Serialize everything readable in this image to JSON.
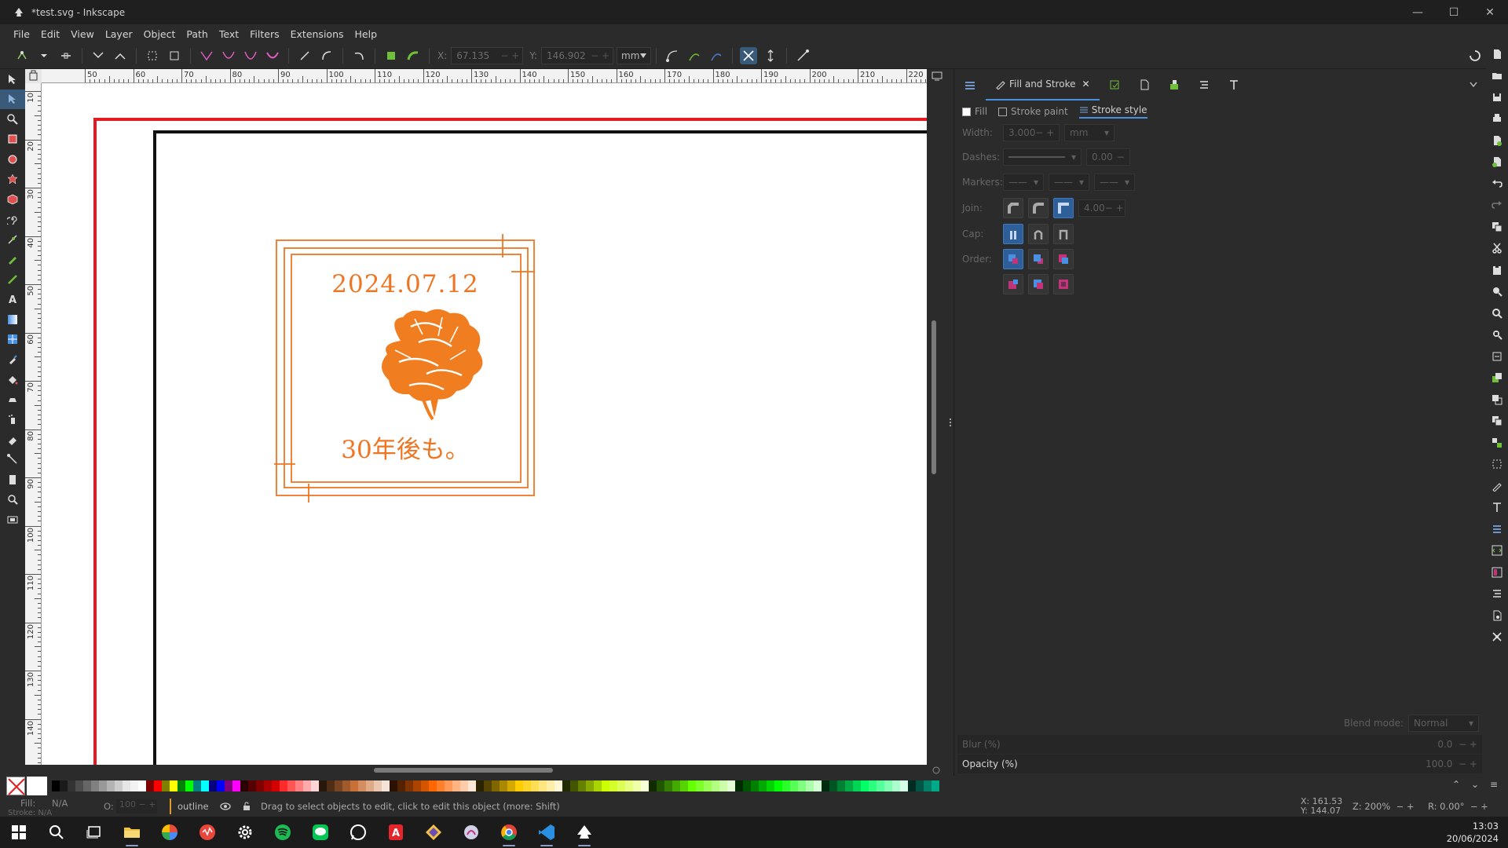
{
  "window": {
    "title": "*test.svg - Inkscape",
    "minimize": "—",
    "maximize": "☐",
    "close": "✕"
  },
  "menu": [
    "File",
    "Edit",
    "View",
    "Layer",
    "Object",
    "Path",
    "Text",
    "Filters",
    "Extensions",
    "Help"
  ],
  "tool_controls": {
    "x_label": "X:",
    "x_value": "67.135",
    "y_label": "Y:",
    "y_value": "146.902",
    "unit": "mm"
  },
  "rulers": {
    "horizontal": [
      "50",
      "60",
      "70",
      "80",
      "90",
      "100",
      "110",
      "120",
      "130",
      "140",
      "150",
      "160",
      "170",
      "180",
      "190",
      "200",
      "210",
      "220"
    ],
    "vertical": [
      "10",
      "20",
      "30",
      "40",
      "50",
      "60",
      "70",
      "80",
      "90",
      "100",
      "110",
      "120",
      "130",
      "140"
    ]
  },
  "artwork": {
    "date": "2024.07.12",
    "caption": "30年後も。",
    "stamp_color": "#ee7623",
    "page_border_color": "#e31b23"
  },
  "dock": {
    "tab_title": "Fill and Stroke",
    "subtabs": [
      "Fill",
      "Stroke paint",
      "Stroke style"
    ],
    "active_subtab": "Stroke style",
    "width_label": "Width:",
    "width_value": "3.000",
    "width_unit": "mm",
    "dashes_label": "Dashes:",
    "dashes_value": "0.00",
    "markers_label": "Markers:",
    "join_label": "Join:",
    "join_value": "4.00",
    "cap_label": "Cap:",
    "order_label": "Order:",
    "blend_label": "Blend mode:",
    "blend_value": "Normal",
    "blur_label": "Blur (%)",
    "blur_value": "0.0",
    "opacity_label": "Opacity (%)",
    "opacity_value": "100.0"
  },
  "status": {
    "fill_label": "Fill:",
    "fill_value": "N/A",
    "stroke_label": "Stroke:",
    "stroke_value": "N/A",
    "o_label": "O:",
    "o_value": "100",
    "layer": "outline",
    "message": "Drag to select objects to edit, click to edit this object (more: Shift)",
    "x_label": "X:",
    "x_value": "161.53",
    "y_label": "Y:",
    "y_value": "144.07",
    "zoom_label": "Z:",
    "zoom_value": "200%",
    "rotate_label": "R:",
    "rotate_value": "0.00°"
  },
  "taskbar": {
    "time": "13:03",
    "date": "20/06/2024"
  }
}
